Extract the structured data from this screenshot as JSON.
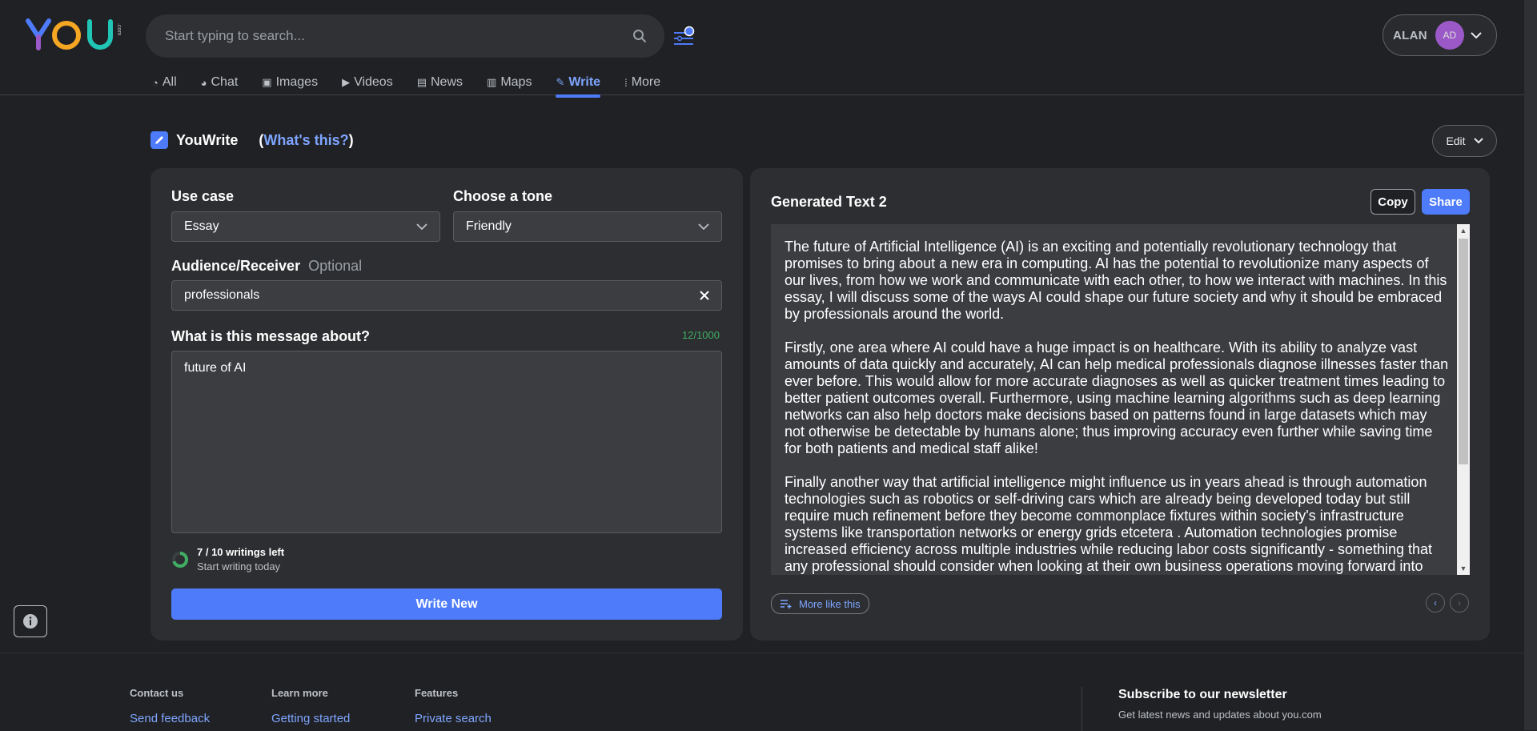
{
  "header": {
    "search_placeholder": "Start typing to search...",
    "user_name": "ALAN",
    "avatar_initials": "AD"
  },
  "nav": [
    {
      "label": "All",
      "icon": "search-circle-icon"
    },
    {
      "label": "Chat",
      "icon": "chat-icon"
    },
    {
      "label": "Images",
      "icon": "image-icon"
    },
    {
      "label": "Videos",
      "icon": "play-icon"
    },
    {
      "label": "News",
      "icon": "newspaper-icon"
    },
    {
      "label": "Maps",
      "icon": "map-icon"
    },
    {
      "label": "Write",
      "icon": "pencil-icon",
      "active": true
    },
    {
      "label": "More",
      "icon": "grid-dots-icon"
    }
  ],
  "youwrite": {
    "title": "YouWrite",
    "whats_this": "What's this?",
    "edit_label": "Edit"
  },
  "form": {
    "use_case_label": "Use case",
    "use_case_value": "Essay",
    "tone_label": "Choose a tone",
    "tone_value": "Friendly",
    "audience_label": "Audience/Receiver",
    "audience_optional": "Optional",
    "audience_value": "professionals",
    "message_label": "What is this message about?",
    "message_counter": "12/1000",
    "message_value": "future of AI",
    "quota_main": "7 / 10 writings left",
    "quota_sub": "Start writing today",
    "write_new_label": "Write New",
    "quota_fraction": 0.7
  },
  "generated": {
    "title": "Generated Text 2",
    "copy_label": "Copy",
    "share_label": "Share",
    "paragraphs": [
      "The future of Artificial Intelligence (AI) is an exciting and potentially revolutionary technology that promises to bring about a new era in computing. AI has the potential to revolutionize many aspects of our lives, from how we work and communicate with each other, to how we interact with machines. In this essay, I will discuss some of the ways AI could shape our future society and why it should be embraced by professionals around the world.",
      "Firstly, one area where AI could have a huge impact is on healthcare. With its ability to analyze vast amounts of data quickly and accurately, AI can help medical professionals diagnose illnesses faster than ever before. This would allow for more accurate diagnoses as well as quicker treatment times leading to better patient outcomes overall. Furthermore, using machine learning algorithms such as deep learning networks can also help doctors make decisions based on patterns found in large datasets which may not otherwise be detectable by humans alone; thus improving accuracy even further while saving time for both patients and medical staff alike!",
      "Finally another way that artificial intelligence might influence us in years ahead is through automation technologies such as robotics or self-driving cars which are already being developed today but still require much refinement before they become commonplace fixtures within society's infrastructure systems like transportation networks or energy grids etcetera . Automation technologies promise increased efficiency across multiple industries while reducing labor costs significantly - something that any professional should consider when looking at their own business operations moving forward into"
    ],
    "more_like_this": "More like this"
  },
  "footer": {
    "columns": [
      {
        "head": "Contact us",
        "link": "Send feedback"
      },
      {
        "head": "Learn more",
        "link": "Getting started"
      },
      {
        "head": "Features",
        "link": "Private search"
      }
    ],
    "newsletter_title": "Subscribe to our newsletter",
    "newsletter_sub": "Get latest news and updates about you.com"
  },
  "colors": {
    "accent": "#4d7bfa",
    "link": "#7ea5ff",
    "counter": "#3fae63",
    "background": "#202124",
    "panel": "#2d2e31"
  }
}
